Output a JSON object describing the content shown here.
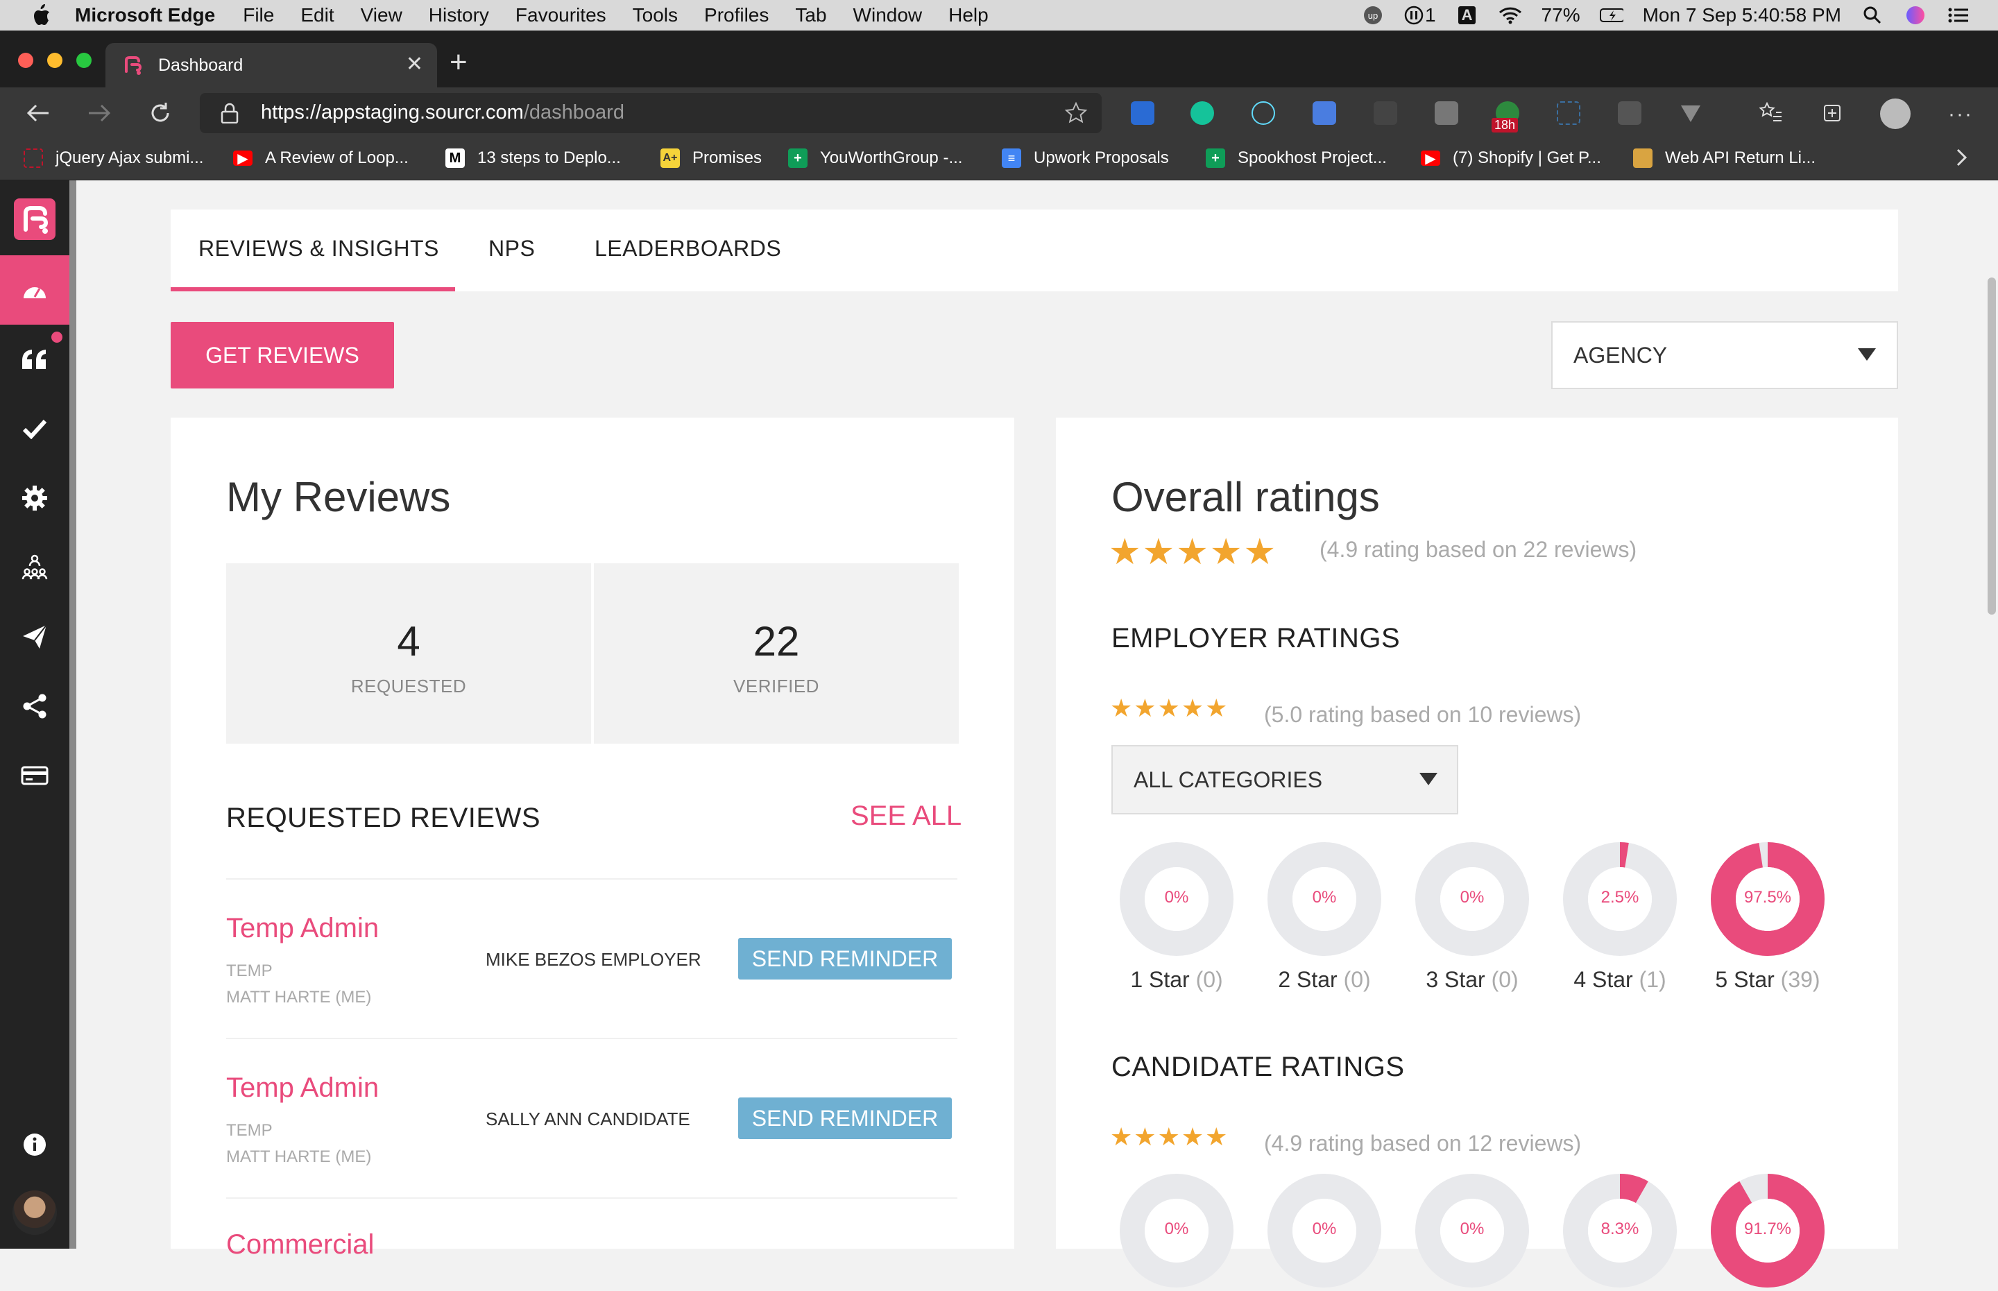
{
  "menubar": {
    "app": "Microsoft Edge",
    "items": [
      "File",
      "Edit",
      "View",
      "History",
      "Favourites",
      "Tools",
      "Profiles",
      "Tab",
      "Window",
      "Help"
    ],
    "status_one": "1",
    "status_a": "A",
    "battery": "77%",
    "datetime": "Mon 7 Sep  5:40:58 PM"
  },
  "browser": {
    "tab_title": "Dashboard",
    "url_scheme": "https://",
    "url_host": "appstaging.sourcr.com",
    "url_path": "/dashboard",
    "ext_badge": "18h",
    "bookmarks": [
      "jQuery Ajax submi...",
      "A Review of Loop...",
      "13 steps to Deplo...",
      "Promises",
      "YouWorthGroup -...",
      "Upwork Proposals",
      "Spookhost Project...",
      "(7) Shopify | Get P...",
      "Web API Return Li..."
    ]
  },
  "tabs": {
    "reviews": "REVIEWS & INSIGHTS",
    "nps": "NPS",
    "leaderboards": "LEADERBOARDS"
  },
  "actions": {
    "get_reviews": "GET REVIEWS",
    "agency_select": "AGENCY"
  },
  "my_reviews": {
    "title": "My Reviews",
    "requested_count": "4",
    "requested_label": "REQUESTED",
    "verified_count": "22",
    "verified_label": "VERIFIED",
    "requested_heading": "REQUESTED REVIEWS",
    "see_all": "SEE ALL",
    "rows": [
      {
        "name": "Temp Admin",
        "sub1": "TEMP",
        "sub2": "MATT HARTE (ME)",
        "person": "MIKE BEZOS EMPLOYER",
        "action": "SEND REMINDER"
      },
      {
        "name": "Temp Admin",
        "sub1": "TEMP",
        "sub2": "MATT HARTE (ME)",
        "person": "SALLY ANN CANDIDATE",
        "action": "SEND REMINDER"
      },
      {
        "name": "Commercial"
      }
    ]
  },
  "overall": {
    "title": "Overall ratings",
    "stars": 5,
    "note": "(4.9 rating based on 22 reviews)",
    "employer_heading": "EMPLOYER RATINGS",
    "employer_note": "(5.0 rating based on 10 reviews)",
    "category_select": "ALL CATEGORIES",
    "employer_breakdown": [
      {
        "pct_label": "0%",
        "pct": 0,
        "label": "1 Star",
        "count": "(0)"
      },
      {
        "pct_label": "0%",
        "pct": 0,
        "label": "2 Star",
        "count": "(0)"
      },
      {
        "pct_label": "0%",
        "pct": 0,
        "label": "3 Star",
        "count": "(0)"
      },
      {
        "pct_label": "2.5%",
        "pct": 2.5,
        "label": "4 Star",
        "count": "(1)"
      },
      {
        "pct_label": "97.5%",
        "pct": 97.5,
        "label": "5 Star",
        "count": "(39)"
      }
    ],
    "candidate_heading": "CANDIDATE RATINGS",
    "candidate_note": "(4.9 rating based on 12 reviews)",
    "candidate_breakdown": [
      {
        "pct_label": "0%",
        "pct": 0
      },
      {
        "pct_label": "0%",
        "pct": 0
      },
      {
        "pct_label": "0%",
        "pct": 0
      },
      {
        "pct_label": "8.3%",
        "pct": 8.3
      },
      {
        "pct_label": "91.7%",
        "pct": 91.7
      }
    ]
  },
  "colors": {
    "accent": "#e94b7c",
    "remind": "#6fb0d2",
    "star": "#f2a52e",
    "donut_bg": "#e8e9ec"
  }
}
